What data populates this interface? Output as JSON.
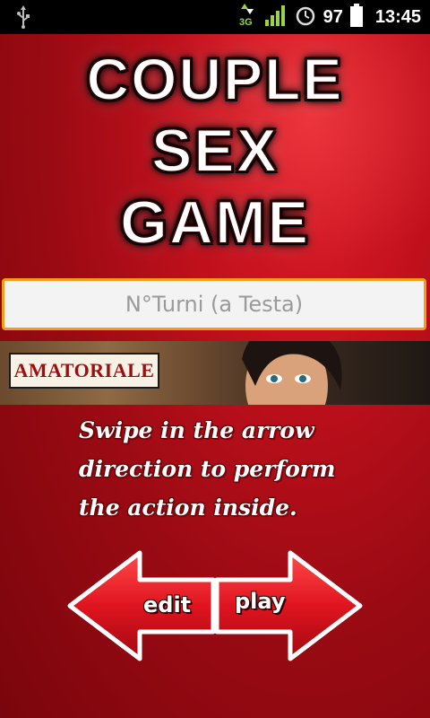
{
  "status_bar": {
    "usb_icon": "usb-icon",
    "network_label": "3G",
    "battery": "97",
    "time": "13:45"
  },
  "title": {
    "line1": "COUPLE",
    "line2": "SEX",
    "line3": "GAME"
  },
  "turns_input": {
    "placeholder": "N°Turni (a Testa)",
    "value": ""
  },
  "ad_banner": {
    "logo_text": "AMATORIALE"
  },
  "instructions": {
    "text": "Swipe in the arrow direction to perform the action inside."
  },
  "arrows": {
    "left_label": "edit",
    "right_label": "play"
  },
  "colors": {
    "background": "#b0101a",
    "input_border": "#f39c17",
    "arrow_red": "#d8141f"
  }
}
